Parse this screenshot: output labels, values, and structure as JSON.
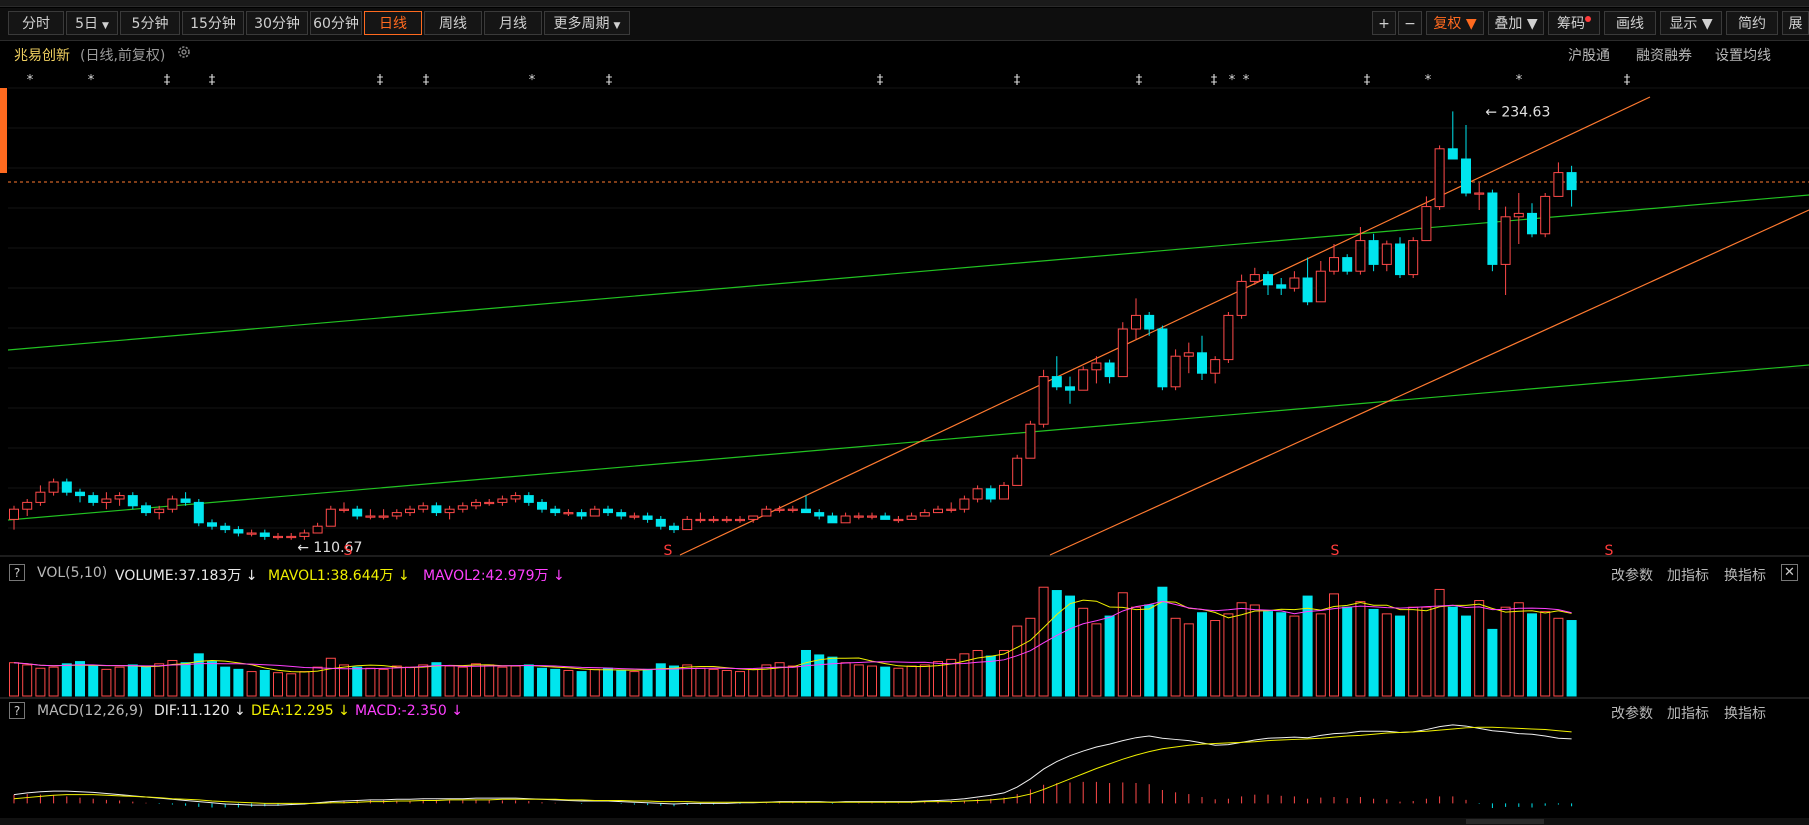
{
  "period_bar": {
    "items": [
      "分时",
      "5日",
      "5分钟",
      "15分钟",
      "30分钟",
      "60分钟",
      "日线",
      "周线",
      "月线",
      "更多周期"
    ],
    "active": "日线"
  },
  "right_toolbar": {
    "plus": "+",
    "minus": "−",
    "fuquan": "复权",
    "diejia": "叠加",
    "chouma": "筹码",
    "huaxian": "画线",
    "xianshi": "显示",
    "jianyue": "简约",
    "zhan": "展"
  },
  "info": {
    "name": "兆易创新",
    "mode": "(日线,前复权)",
    "links": [
      "沪股通",
      "融资融券",
      "设置均线"
    ]
  },
  "price_labels": {
    "high": "234.63",
    "low": "110.67"
  },
  "vol_panel": {
    "q": "?",
    "title": "VOL(5,10)",
    "volume": "VOLUME:37.183万",
    "mavol1": "MAVOL1:38.644万",
    "mavol2": "MAVOL2:42.979万",
    "links": [
      "改参数",
      "加指标",
      "换指标"
    ],
    "close": "✕"
  },
  "macd_panel": {
    "q": "?",
    "title": "MACD(12,26,9)",
    "dif": "DIF:11.120",
    "dea": "DEA:12.295",
    "macd": "MACD:-2.350",
    "links": [
      "改参数",
      "加指标",
      "换指标"
    ]
  },
  "colors": {
    "up": "#ff4a4a",
    "down": "#00e5ee",
    "yellow": "#f0f000",
    "magenta": "#ff40ff",
    "green_line": "#22c322",
    "orange_line": "#ff7a30",
    "accent": "#ff6a1f"
  },
  "chart_data": {
    "type": "candlestick",
    "series_ohlc": [
      [
        114,
        118,
        111,
        117
      ],
      [
        117,
        120,
        115,
        119
      ],
      [
        119,
        124,
        118,
        122
      ],
      [
        122,
        126,
        121,
        125
      ],
      [
        125,
        126,
        121,
        122
      ],
      [
        122,
        123,
        119,
        121
      ],
      [
        121,
        122,
        118,
        119
      ],
      [
        119,
        122,
        117,
        120
      ],
      [
        120,
        122,
        118,
        121
      ],
      [
        121,
        122,
        117,
        118
      ],
      [
        118,
        119,
        115,
        116
      ],
      [
        116,
        118,
        114,
        117
      ],
      [
        117,
        121,
        116,
        120
      ],
      [
        120,
        122,
        118,
        119
      ],
      [
        119,
        120,
        112,
        113
      ],
      [
        113,
        114,
        111,
        112
      ],
      [
        112,
        113,
        110,
        111
      ],
      [
        111,
        112,
        109,
        110
      ],
      [
        110,
        111,
        109,
        110
      ],
      [
        110,
        111,
        108,
        109
      ],
      [
        109,
        110,
        108,
        109
      ],
      [
        109,
        110,
        108,
        109
      ],
      [
        109,
        111,
        108,
        110
      ],
      [
        110,
        113,
        110,
        112
      ],
      [
        112,
        118,
        112,
        117
      ],
      [
        117,
        119,
        116,
        117
      ],
      [
        117,
        118,
        114,
        115
      ],
      [
        115,
        117,
        114,
        115
      ],
      [
        115,
        117,
        114,
        115
      ],
      [
        115,
        117,
        114,
        116
      ],
      [
        116,
        118,
        115,
        117
      ],
      [
        117,
        119,
        116,
        118
      ],
      [
        118,
        119,
        115,
        116
      ],
      [
        116,
        118,
        114,
        117
      ],
      [
        117,
        119,
        116,
        118
      ],
      [
        118,
        120,
        117,
        119
      ],
      [
        119,
        120,
        118,
        119
      ],
      [
        119,
        121,
        118,
        120
      ],
      [
        120,
        122,
        119,
        121
      ],
      [
        121,
        122,
        118,
        119
      ],
      [
        119,
        120,
        116,
        117
      ],
      [
        117,
        118,
        115,
        116
      ],
      [
        116,
        117,
        115,
        116
      ],
      [
        116,
        117,
        114,
        115
      ],
      [
        115,
        118,
        115,
        117
      ],
      [
        117,
        118,
        115,
        116
      ],
      [
        116,
        117,
        114,
        115
      ],
      [
        115,
        116,
        114,
        115
      ],
      [
        115,
        116,
        113,
        114
      ],
      [
        114,
        115,
        111,
        112
      ],
      [
        112,
        113,
        110,
        111
      ],
      [
        111,
        115,
        111,
        114
      ],
      [
        114,
        116,
        113,
        114
      ],
      [
        114,
        115,
        113,
        114
      ],
      [
        114,
        115,
        113,
        114
      ],
      [
        114,
        115,
        113,
        114
      ],
      [
        114,
        115,
        113,
        115
      ],
      [
        115,
        118,
        115,
        117
      ],
      [
        117,
        118,
        116,
        117
      ],
      [
        117,
        118,
        116,
        117
      ],
      [
        117,
        121,
        116,
        116
      ],
      [
        116,
        117,
        114,
        115
      ],
      [
        115,
        116,
        113,
        113
      ],
      [
        113,
        116,
        113,
        115
      ],
      [
        115,
        116,
        114,
        115
      ],
      [
        115,
        116,
        114,
        115
      ],
      [
        115,
        116,
        114,
        114
      ],
      [
        114,
        115,
        113,
        114
      ],
      [
        114,
        116,
        114,
        115
      ],
      [
        115,
        117,
        115,
        116
      ],
      [
        116,
        118,
        116,
        117
      ],
      [
        117,
        119,
        116,
        117
      ],
      [
        117,
        121,
        116,
        120
      ],
      [
        120,
        124,
        119,
        123
      ],
      [
        123,
        124,
        119,
        120
      ],
      [
        120,
        125,
        120,
        124
      ],
      [
        124,
        133,
        124,
        132
      ],
      [
        132,
        143,
        132,
        142
      ],
      [
        142,
        158,
        141,
        156
      ],
      [
        156,
        162,
        152,
        153
      ],
      [
        153,
        156,
        148,
        152
      ],
      [
        152,
        159,
        152,
        158
      ],
      [
        158,
        162,
        154,
        160
      ],
      [
        160,
        161,
        154,
        156
      ],
      [
        156,
        172,
        156,
        170
      ],
      [
        170,
        179,
        167,
        174
      ],
      [
        174,
        175,
        168,
        170
      ],
      [
        170,
        171,
        152,
        153
      ],
      [
        153,
        164,
        152,
        162
      ],
      [
        162,
        166,
        157,
        163
      ],
      [
        163,
        168,
        155,
        157
      ],
      [
        157,
        162,
        154,
        161
      ],
      [
        161,
        175,
        160,
        174
      ],
      [
        174,
        186,
        173,
        184
      ],
      [
        184,
        188,
        183,
        186
      ],
      [
        186,
        187,
        180,
        183
      ],
      [
        183,
        185,
        180,
        182
      ],
      [
        182,
        187,
        181,
        185
      ],
      [
        185,
        191,
        177,
        178
      ],
      [
        178,
        190,
        178,
        187
      ],
      [
        187,
        195,
        186,
        191
      ],
      [
        191,
        192,
        186,
        187
      ],
      [
        187,
        200,
        186,
        196
      ],
      [
        196,
        198,
        187,
        189
      ],
      [
        189,
        196,
        187,
        195
      ],
      [
        195,
        197,
        185,
        186
      ],
      [
        186,
        197,
        185,
        196
      ],
      [
        196,
        209,
        196,
        206
      ],
      [
        206,
        224,
        205,
        223
      ],
      [
        223,
        234,
        221,
        220
      ],
      [
        220,
        230,
        209,
        210
      ],
      [
        210,
        213,
        205,
        210
      ],
      [
        210,
        211,
        187,
        189
      ],
      [
        189,
        206,
        180,
        203
      ],
      [
        203,
        210,
        195,
        204
      ],
      [
        204,
        207,
        197,
        198
      ],
      [
        198,
        210,
        197,
        209
      ],
      [
        209,
        219,
        209,
        216
      ],
      [
        216,
        218,
        206,
        211
      ]
    ],
    "high_label": "234.63",
    "low_label": "110.67",
    "volume": [
      30,
      28,
      25,
      26,
      29,
      31,
      27,
      24,
      26,
      28,
      27,
      29,
      32,
      30,
      38,
      31,
      26,
      24,
      22,
      23,
      21,
      20,
      22,
      26,
      34,
      28,
      26,
      25,
      24,
      27,
      26,
      28,
      30,
      27,
      26,
      29,
      28,
      26,
      27,
      28,
      25,
      24,
      23,
      22,
      24,
      25,
      23,
      22,
      24,
      29,
      27,
      28,
      25,
      24,
      23,
      22,
      24,
      28,
      30,
      27,
      41,
      37,
      35,
      30,
      28,
      27,
      26,
      25,
      27,
      28,
      31,
      33,
      38,
      41,
      36,
      41,
      63,
      70,
      98,
      95,
      90,
      79,
      65,
      72,
      93,
      80,
      82,
      98,
      70,
      65,
      75,
      68,
      74,
      84,
      82,
      76,
      75,
      72,
      90,
      74,
      92,
      80,
      85,
      78,
      74,
      72,
      80,
      80,
      96,
      80,
      72,
      86,
      60,
      80,
      84,
      74,
      76,
      70,
      68
    ],
    "volume_ymax": 100,
    "macd_hist": [
      1.5,
      1.6,
      1.5,
      1.4,
      1.2,
      1.0,
      0.8,
      0.6,
      0.5,
      0.3,
      0.1,
      -0.1,
      -0.2,
      -0.4,
      -0.6,
      -0.7,
      -0.7,
      -0.7,
      -0.6,
      -0.5,
      -0.4,
      -0.3,
      -0.2,
      0.1,
      0.4,
      0.5,
      0.6,
      0.6,
      0.5,
      0.5,
      0.5,
      0.6,
      0.6,
      0.5,
      0.5,
      0.6,
      0.6,
      0.5,
      0.5,
      0.4,
      0.2,
      0.1,
      0.0,
      -0.1,
      0.0,
      0.0,
      -0.1,
      -0.2,
      -0.3,
      -0.4,
      -0.5,
      -0.3,
      -0.2,
      -0.2,
      -0.1,
      -0.1,
      0.0,
      0.1,
      0.2,
      0.2,
      0.1,
      0.0,
      -0.1,
      0.0,
      0.1,
      0.1,
      0.1,
      0.1,
      0.1,
      0.2,
      0.3,
      0.3,
      0.5,
      0.7,
      0.8,
      1.0,
      1.6,
      2.4,
      3.2,
      3.5,
      3.6,
      3.7,
      3.7,
      3.5,
      3.6,
      3.5,
      3.3,
      2.3,
      1.9,
      1.6,
      1.1,
      0.7,
      0.8,
      1.2,
      1.5,
      1.5,
      1.3,
      1.2,
      0.8,
      1.0,
      1.1,
      0.9,
      1.1,
      0.8,
      0.7,
      0.3,
      0.4,
      0.8,
      1.2,
      1.2,
      0.6,
      -0.1,
      -0.8,
      -0.6,
      -0.6,
      -0.7,
      -0.4,
      -0.2,
      -0.5
    ],
    "dif_line": [
      1.5,
      1.8,
      2.0,
      2.1,
      2.1,
      2.0,
      1.9,
      1.7,
      1.5,
      1.3,
      1.1,
      0.9,
      0.7,
      0.5,
      0.3,
      0.1,
      -0.1,
      -0.2,
      -0.3,
      -0.3,
      -0.3,
      -0.2,
      -0.1,
      0.1,
      0.3,
      0.4,
      0.5,
      0.6,
      0.6,
      0.7,
      0.7,
      0.8,
      0.8,
      0.8,
      0.8,
      0.9,
      0.9,
      0.9,
      0.9,
      0.8,
      0.7,
      0.6,
      0.5,
      0.4,
      0.4,
      0.4,
      0.3,
      0.2,
      0.1,
      0.0,
      -0.1,
      0.0,
      0.0,
      0.0,
      0.0,
      0.1,
      0.1,
      0.2,
      0.3,
      0.3,
      0.3,
      0.3,
      0.2,
      0.3,
      0.3,
      0.3,
      0.3,
      0.3,
      0.3,
      0.4,
      0.5,
      0.6,
      0.8,
      1.1,
      1.4,
      1.8,
      2.8,
      4.2,
      5.9,
      7.2,
      8.2,
      9.0,
      9.7,
      10.2,
      10.8,
      11.3,
      11.6,
      11.2,
      11.0,
      10.8,
      10.4,
      10.0,
      10.1,
      10.5,
      10.9,
      11.2,
      11.3,
      11.4,
      11.3,
      11.7,
      12.0,
      12.1,
      12.4,
      12.4,
      12.4,
      12.2,
      12.3,
      12.7,
      13.2,
      13.5,
      13.3,
      12.9,
      12.5,
      12.3,
      12.0,
      11.9,
      11.6,
      11.2,
      11.1
    ],
    "dea_line": [
      0.8,
      1.0,
      1.2,
      1.4,
      1.5,
      1.5,
      1.5,
      1.4,
      1.3,
      1.2,
      1.1,
      1.0,
      0.8,
      0.7,
      0.6,
      0.4,
      0.3,
      0.2,
      0.1,
      0.0,
      0.0,
      0.0,
      0.0,
      0.0,
      0.1,
      0.1,
      0.2,
      0.3,
      0.3,
      0.4,
      0.4,
      0.5,
      0.5,
      0.6,
      0.6,
      0.6,
      0.6,
      0.7,
      0.7,
      0.7,
      0.7,
      0.7,
      0.6,
      0.6,
      0.5,
      0.5,
      0.5,
      0.4,
      0.4,
      0.3,
      0.3,
      0.3,
      0.2,
      0.2,
      0.2,
      0.2,
      0.2,
      0.2,
      0.2,
      0.2,
      0.2,
      0.2,
      0.2,
      0.2,
      0.2,
      0.2,
      0.2,
      0.2,
      0.2,
      0.3,
      0.3,
      0.3,
      0.4,
      0.5,
      0.6,
      0.8,
      1.1,
      1.6,
      2.4,
      3.3,
      4.2,
      5.1,
      6.0,
      6.8,
      7.6,
      8.3,
      8.9,
      9.4,
      9.7,
      10.0,
      10.2,
      10.3,
      10.4,
      10.5,
      10.6,
      10.8,
      10.9,
      11.0,
      11.1,
      11.2,
      11.4,
      11.6,
      11.7,
      11.9,
      12.1,
      12.2,
      12.3,
      12.4,
      12.6,
      12.8,
      13.0,
      13.1,
      13.1,
      13.0,
      12.9,
      12.8,
      12.7,
      12.5,
      12.3
    ],
    "macd_range": [
      -2,
      14
    ],
    "price_range": [
      105,
      240
    ]
  }
}
